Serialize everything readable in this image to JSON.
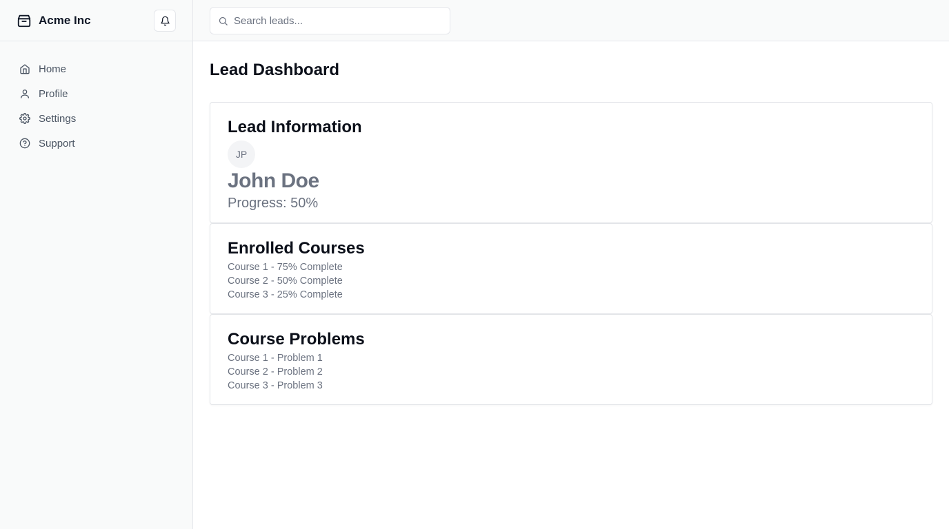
{
  "brand": {
    "name": "Acme Inc",
    "icon": "package-icon"
  },
  "sidebar": {
    "items": [
      {
        "label": "Home",
        "icon": "home-icon"
      },
      {
        "label": "Profile",
        "icon": "user-icon"
      },
      {
        "label": "Settings",
        "icon": "gear-icon"
      },
      {
        "label": "Support",
        "icon": "help-circle-icon"
      }
    ]
  },
  "search": {
    "placeholder": "Search leads...",
    "value": ""
  },
  "page": {
    "title": "Lead Dashboard"
  },
  "lead_card": {
    "title": "Lead Information",
    "avatar_initials": "JP",
    "name": "John Doe",
    "progress_text": "Progress: 50%",
    "progress_fraction": 0.5
  },
  "courses_card": {
    "title": "Enrolled Courses",
    "items": [
      "Course 1 - 75% Complete",
      "Course 2 - 50% Complete",
      "Course 3 - 25% Complete"
    ]
  },
  "problems_card": {
    "title": "Course Problems",
    "items": [
      "Course 1 - Problem 1",
      "Course 2 - Problem 2",
      "Course 3 - Problem 3"
    ]
  },
  "colors": {
    "sidebar_bg": "#f9fafa",
    "border": "#e5e7eb",
    "muted_text": "#6b7280",
    "heading": "#0b0f19"
  }
}
